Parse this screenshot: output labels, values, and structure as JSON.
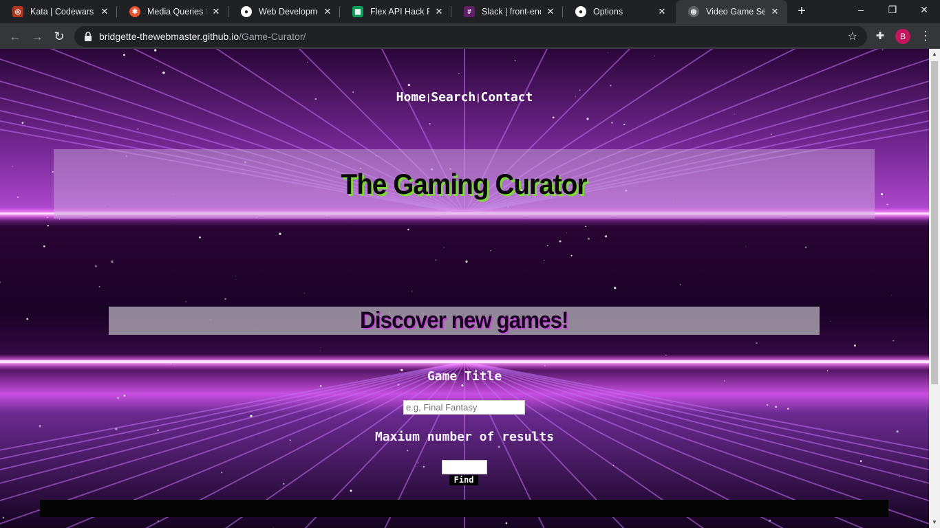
{
  "browser": {
    "tabs": [
      {
        "title": "Kata | Codewars",
        "icon": "codewars-icon",
        "color": "#b1361e"
      },
      {
        "title": "Media Queries for",
        "icon": "css-tricks-icon",
        "color": "#e8542f"
      },
      {
        "title": "Web Development",
        "icon": "github-icon",
        "color": "#ffffff"
      },
      {
        "title": "Flex API Hack Rub",
        "icon": "sheets-icon",
        "color": "#0f9d58"
      },
      {
        "title": "Slack | front-end-w",
        "icon": "slack-icon",
        "color": "#611f69"
      },
      {
        "title": "Options",
        "icon": "github-icon",
        "color": "#ffffff"
      },
      {
        "title": "Video Game Seeke",
        "icon": "globe-icon",
        "color": "#9aa0a6",
        "active": true
      }
    ],
    "new_tab": "+",
    "window_controls": {
      "minimize": "–",
      "restore": "❐",
      "close": "✕"
    },
    "url": {
      "host": "bridgette-thewebmaster.github.io",
      "path": "/Game-Curator/"
    },
    "profile_initial": "B"
  },
  "page": {
    "nav": {
      "home": "Home",
      "separator": "|",
      "search": "Search",
      "contact": "Contact"
    },
    "title": "The Gaming Curator",
    "subtitle": "Discover new games!",
    "game_title_label": "Game Title",
    "game_title_placeholder": "e.g, Final Fantasy",
    "max_results_label": "Maxium number of results",
    "max_results_value": "",
    "find_button": "Find"
  },
  "colors": {
    "accent_pink": "#ff40ff",
    "title_shadow": "#7cd93a",
    "background": "#1a0226"
  }
}
